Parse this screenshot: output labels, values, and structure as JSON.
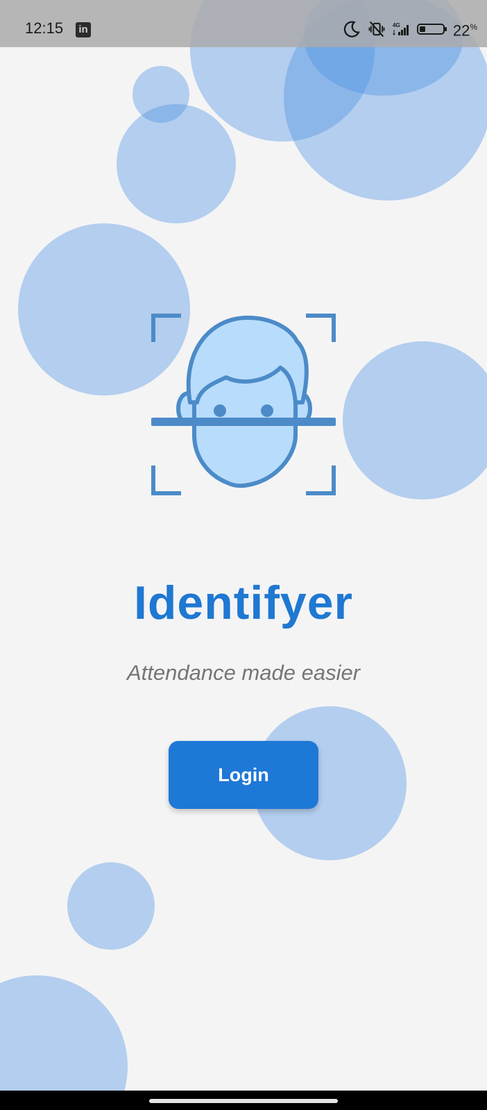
{
  "status_bar": {
    "time": "12:15",
    "notification_icon": "linkedin-icon",
    "icons": [
      "moon-icon",
      "muted-vibrate-icon",
      "4g-signal-icon",
      "battery-icon"
    ],
    "network_label": "4G",
    "battery_percent": "22",
    "battery_percent_sign": "%"
  },
  "main": {
    "logo_icon": "face-scan-icon",
    "app_title": "Identifyer",
    "subtitle": "Attendance made easier",
    "login_label": "Login"
  },
  "colors": {
    "accent": "#1e78d6",
    "title": "#1f78d1",
    "bubble": "#4a90e2",
    "face_fill": "#b8dcfb",
    "face_stroke": "#4c8bc8",
    "background": "#f4f4f5"
  }
}
